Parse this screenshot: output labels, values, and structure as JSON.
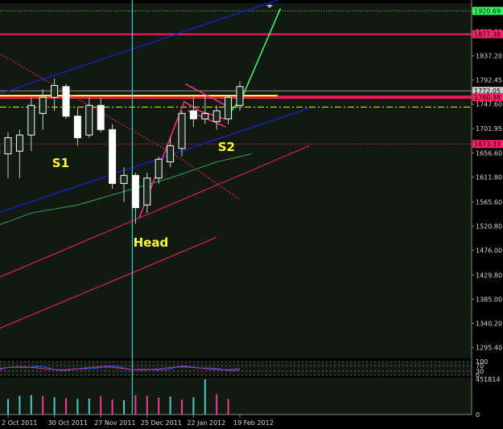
{
  "chart_data": {
    "type": "candlestick",
    "colors": {
      "background": "#111a11",
      "bull": "#ffffff",
      "bear": "#ffffff",
      "wick": "#c8c8c8",
      "grid": "#2e3b2e",
      "channel": "#1f1fd9",
      "moving_average": "#22aa55",
      "red_line": "#ff2266",
      "pattern": "#ff2e8a",
      "projection": "#33ff66",
      "neckline": "#ffff00",
      "cursor": "#33cccc",
      "volume_bull": "#44cccc",
      "volume_bear": "#ff3399"
    },
    "y_axis": {
      "ylim": [
        1275,
        1935
      ],
      "ticks": [
        "1920.90",
        "1882.30",
        "1837.20",
        "1792.45",
        "1747.60",
        "1701.95",
        "1656.60",
        "1611.80",
        "1565.60",
        "1520.80",
        "1476.00",
        "1429.80",
        "1385.00",
        "1340.20",
        "1295.40"
      ]
    },
    "price_tags": [
      {
        "text": "1920.69",
        "value": 1920.69,
        "color": "#33ff66"
      },
      {
        "text": "1877.38",
        "value": 1877.38,
        "color": "#ff2266"
      },
      {
        "text": "1772.05",
        "value": 1772.05,
        "color": "#cccccc"
      },
      {
        "text": "1760.38",
        "value": 1760.38,
        "color": "#ff2266"
      },
      {
        "text": "1673.33",
        "value": 1673.33,
        "color": "#ff2266"
      }
    ],
    "x_axis": {
      "date_labels": [
        "2 Oct 2011",
        "30 Oct 2011",
        "27 Nov 2011",
        "25 Dec 2011",
        "22 Jan 2012",
        "19 Feb 2012"
      ],
      "date_label_weeks": [
        0,
        4,
        8,
        12,
        16,
        20
      ]
    },
    "candles": [
      {
        "week": -3,
        "open": 1605,
        "high": 1650,
        "low": 1595,
        "close": 1640
      },
      {
        "week": -2,
        "open": 1640,
        "high": 1700,
        "low": 1610,
        "close": 1675
      },
      {
        "week": -1,
        "open": 1670,
        "high": 1690,
        "low": 1640,
        "close": 1655
      },
      {
        "week": 0,
        "open": 1655,
        "high": 1695,
        "low": 1610,
        "close": 1685
      },
      {
        "week": 1,
        "open": 1660,
        "high": 1700,
        "low": 1610,
        "close": 1690
      },
      {
        "week": 2,
        "open": 1690,
        "high": 1760,
        "low": 1660,
        "close": 1745
      },
      {
        "week": 3,
        "open": 1730,
        "high": 1775,
        "low": 1700,
        "close": 1760
      },
      {
        "week": 4,
        "open": 1760,
        "high": 1795,
        "low": 1735,
        "close": 1782
      },
      {
        "week": 5,
        "open": 1780,
        "high": 1785,
        "low": 1720,
        "close": 1725
      },
      {
        "week": 6,
        "open": 1725,
        "high": 1740,
        "low": 1670,
        "close": 1685
      },
      {
        "week": 7,
        "open": 1690,
        "high": 1760,
        "low": 1685,
        "close": 1745
      },
      {
        "week": 8,
        "open": 1745,
        "high": 1760,
        "low": 1695,
        "close": 1700
      },
      {
        "week": 9,
        "open": 1700,
        "high": 1710,
        "low": 1590,
        "close": 1600
      },
      {
        "week": 10,
        "open": 1600,
        "high": 1630,
        "low": 1565,
        "close": 1615
      },
      {
        "week": 11,
        "open": 1615,
        "high": 1620,
        "low": 1525,
        "close": 1555
      },
      {
        "week": 12,
        "open": 1560,
        "high": 1620,
        "low": 1545,
        "close": 1610
      },
      {
        "week": 13,
        "open": 1610,
        "high": 1650,
        "low": 1600,
        "close": 1645
      },
      {
        "week": 14,
        "open": 1640,
        "high": 1685,
        "low": 1630,
        "close": 1670
      },
      {
        "week": 15,
        "open": 1665,
        "high": 1735,
        "low": 1650,
        "close": 1730
      },
      {
        "week": 16,
        "open": 1735,
        "high": 1760,
        "low": 1705,
        "close": 1720
      },
      {
        "week": 17,
        "open": 1720,
        "high": 1765,
        "low": 1710,
        "close": 1730
      },
      {
        "week": 18,
        "open": 1715,
        "high": 1745,
        "low": 1700,
        "close": 1735
      },
      {
        "week": 19,
        "open": 1720,
        "high": 1765,
        "low": 1710,
        "close": 1760
      },
      {
        "week": 20,
        "open": 1745,
        "high": 1790,
        "low": 1735,
        "close": 1780
      }
    ],
    "overlay_lines": [
      {
        "kind": "channel-upper",
        "points": [
          [
            -3,
            1750
          ],
          [
            30,
            1990
          ]
        ]
      },
      {
        "kind": "channel-lower",
        "points": [
          [
            -3,
            1530
          ],
          [
            26,
            1740
          ]
        ]
      },
      {
        "kind": "moving-average",
        "points": [
          [
            -3,
            1505
          ],
          [
            2,
            1545
          ],
          [
            6,
            1560
          ],
          [
            10,
            1585
          ],
          [
            14,
            1610
          ],
          [
            18,
            1640
          ],
          [
            21,
            1655
          ]
        ]
      },
      {
        "kind": "red-trend-1",
        "points": [
          [
            -3,
            1405
          ],
          [
            26,
            1670
          ]
        ]
      },
      {
        "kind": "red-trend-2",
        "points": [
          [
            -3,
            1310
          ],
          [
            18,
            1500
          ]
        ]
      },
      {
        "kind": "red-diagonal",
        "points": [
          [
            -3,
            1870
          ],
          [
            13,
            1670
          ],
          [
            15,
            1645
          ],
          [
            20,
            1570
          ]
        ]
      },
      {
        "kind": "pattern-zigzag",
        "points": [
          [
            11.3,
            1535
          ],
          [
            13.2,
            1640
          ],
          [
            15.2,
            1752
          ],
          [
            16.5,
            1735
          ],
          [
            18.7,
            1720
          ],
          [
            20.2,
            1760
          ],
          [
            22,
            1850
          ],
          [
            23.5,
            1925
          ]
        ]
      },
      {
        "kind": "flag-upper",
        "points": [
          [
            15.3,
            1785
          ],
          [
            18.8,
            1745
          ]
        ]
      },
      {
        "kind": "flag-lower",
        "points": [
          [
            15.5,
            1735
          ],
          [
            18.8,
            1705
          ]
        ]
      }
    ],
    "horizontal_lines": [
      {
        "kind": "target-top",
        "value": 1920.69
      },
      {
        "kind": "red-resistance",
        "value": 1877.38
      },
      {
        "kind": "grey-level",
        "value": 1772.05
      },
      {
        "kind": "neckline",
        "value": 1760.38
      },
      {
        "kind": "dashed-level",
        "value": 1742
      },
      {
        "kind": "red-support",
        "value": 1673.33
      }
    ],
    "cursor_week": 11,
    "annotations": [
      {
        "text": "S1",
        "week": 4.5,
        "value": 1638
      },
      {
        "text": "Head",
        "week": 11.5,
        "value": 1490
      },
      {
        "text": "S2",
        "week": 18.8,
        "value": 1668
      }
    ],
    "oscillator": {
      "ticks": [
        "100",
        "70",
        "30",
        "0"
      ]
    },
    "volume": {
      "ticks": [
        "451814",
        "0"
      ],
      "max": 451814,
      "bars": [
        {
          "week": -3,
          "value": 230000,
          "dir": "down"
        },
        {
          "week": -2,
          "value": 210000,
          "dir": "down"
        },
        {
          "week": -1,
          "value": 180000,
          "dir": "down"
        },
        {
          "week": 0,
          "value": 200000,
          "dir": "up"
        },
        {
          "week": 1,
          "value": 240000,
          "dir": "up"
        },
        {
          "week": 2,
          "value": 250000,
          "dir": "up"
        },
        {
          "week": 3,
          "value": 235000,
          "dir": "down"
        },
        {
          "week": 4,
          "value": 220000,
          "dir": "up"
        },
        {
          "week": 5,
          "value": 210000,
          "dir": "down"
        },
        {
          "week": 6,
          "value": 200000,
          "dir": "up"
        },
        {
          "week": 7,
          "value": 205000,
          "dir": "up"
        },
        {
          "week": 8,
          "value": 235000,
          "dir": "down"
        },
        {
          "week": 9,
          "value": 195000,
          "dir": "down"
        },
        {
          "week": 10,
          "value": 185000,
          "dir": "up"
        },
        {
          "week": 11,
          "value": 250000,
          "dir": "down"
        },
        {
          "week": 12,
          "value": 240000,
          "dir": "down"
        },
        {
          "week": 13,
          "value": 215000,
          "dir": "down"
        },
        {
          "week": 14,
          "value": 230000,
          "dir": "up"
        },
        {
          "week": 15,
          "value": 190000,
          "dir": "down"
        },
        {
          "week": 16,
          "value": 220000,
          "dir": "up"
        },
        {
          "week": 17,
          "value": 451814,
          "dir": "up"
        },
        {
          "week": 18,
          "value": 260000,
          "dir": "down"
        },
        {
          "week": 19,
          "value": 200000,
          "dir": "down"
        }
      ]
    }
  }
}
